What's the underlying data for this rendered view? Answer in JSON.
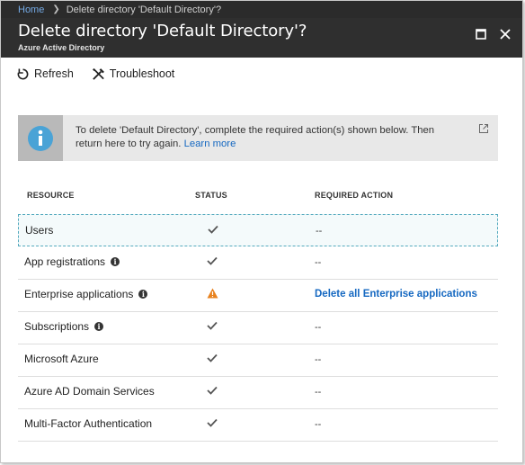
{
  "breadcrumb": {
    "home": "Home",
    "current": "Delete directory 'Default Directory'?"
  },
  "header": {
    "title": "Delete directory 'Default Directory'?",
    "subtitle": "Azure Active Directory"
  },
  "toolbar": {
    "refresh_label": "Refresh",
    "troubleshoot_label": "Troubleshoot"
  },
  "info": {
    "message": "To delete 'Default Directory', complete the required action(s) shown below. Then return here to try again.",
    "link": "Learn more"
  },
  "table": {
    "columns": [
      "RESOURCE",
      "STATUS",
      "REQUIRED ACTION"
    ],
    "rows": [
      {
        "resource": "Users",
        "status": "ok",
        "action": "--"
      },
      {
        "resource": "App registrations",
        "status": "ok",
        "action": "--"
      },
      {
        "resource": "Enterprise applications",
        "status": "warning",
        "action": "Delete all Enterprise applications"
      },
      {
        "resource": "Subscriptions",
        "status": "ok",
        "action": "--"
      },
      {
        "resource": "Microsoft Azure",
        "status": "ok",
        "action": "--"
      },
      {
        "resource": "Azure AD Domain Services",
        "status": "ok",
        "action": "--"
      },
      {
        "resource": "Multi-Factor Authentication",
        "status": "ok",
        "action": "--"
      }
    ]
  },
  "colors": {
    "accent": "#1568c1",
    "warning": "#e8821e",
    "header_bg": "#2f2f2f",
    "info_icon": "#4aa3d6"
  }
}
